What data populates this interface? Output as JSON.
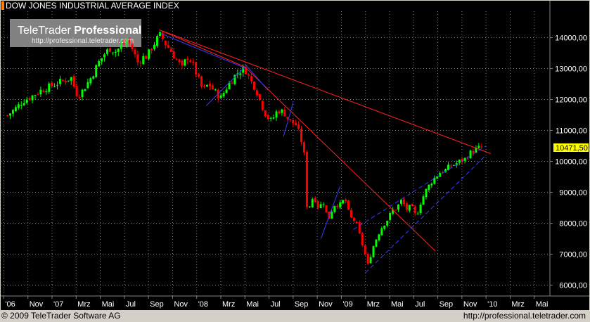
{
  "title": "DOW JONES INDUSTRIAL AVERAGE INDEX",
  "watermark": {
    "brand_plain": "TeleTrader ",
    "brand_bold": "Professional",
    "url": "http://professional.teletrader.com"
  },
  "footer": {
    "copyright": "© 2009 TeleTrader Software AG",
    "url": "http://professional.teletrader.com"
  },
  "last_price_label": "10471,50",
  "colors": {
    "background": "#000000",
    "grid": "#808080",
    "up": "#00ff00",
    "down": "#ff0000",
    "trend_red": "#ff2020",
    "trend_blue": "#3a3aff",
    "frame": "#d4d0c8",
    "title_marker": "#ff8000"
  },
  "chart_data": {
    "type": "candlestick",
    "title": "DOW JONES INDUSTRIAL AVERAGE INDEX",
    "x_tick_labels": [
      "'06",
      "Nov",
      "'07",
      "Mrz",
      "Mai",
      "Jul",
      "Sep",
      "Nov",
      "'08",
      "Mrz",
      "Mai",
      "Jul",
      "Sep",
      "Nov",
      "'09",
      "Mrz",
      "Mai",
      "Jul",
      "Sep",
      "Nov",
      "'10",
      "Mrz",
      "Mai"
    ],
    "x_tick_months": [
      9,
      11,
      13,
      15,
      17,
      19,
      21,
      23,
      25,
      27,
      29,
      31,
      33,
      35,
      37,
      39,
      41,
      43,
      45,
      47,
      49,
      51,
      53
    ],
    "y_ticks": [
      6000,
      7000,
      8000,
      9000,
      10000,
      11000,
      12000,
      13000,
      14000
    ],
    "y_tick_labels": [
      "6000,00",
      "7000,00",
      "8000,00",
      "9000,00",
      "10000,00",
      "11000,00",
      "12000,00",
      "13000,00",
      "14000,00"
    ],
    "ylim": [
      5650,
      14850
    ],
    "xlim": [
      8.8,
      54.3
    ],
    "last_price": 10471.5,
    "weekly_close_anchors": [
      [
        9.3,
        11480
      ],
      [
        10.0,
        11720
      ],
      [
        10.6,
        11950
      ],
      [
        11.3,
        12100
      ],
      [
        12.0,
        12280
      ],
      [
        12.6,
        12380
      ],
      [
        13.3,
        12500
      ],
      [
        13.9,
        12600
      ],
      [
        14.6,
        12700
      ],
      [
        15.0,
        12200
      ],
      [
        15.3,
        12150
      ],
      [
        15.8,
        12450
      ],
      [
        16.3,
        12750
      ],
      [
        16.8,
        13150
      ],
      [
        17.3,
        13450
      ],
      [
        17.8,
        13650
      ],
      [
        18.3,
        13550
      ],
      [
        18.8,
        13750
      ],
      [
        19.3,
        13900
      ],
      [
        19.7,
        13600
      ],
      [
        20.1,
        13200
      ],
      [
        20.5,
        13350
      ],
      [
        20.9,
        13400
      ],
      [
        21.3,
        13700
      ],
      [
        21.7,
        13950
      ],
      [
        22.0,
        14100
      ],
      [
        22.3,
        13850
      ],
      [
        22.8,
        13600
      ],
      [
        23.3,
        13300
      ],
      [
        23.8,
        13000
      ],
      [
        24.2,
        13400
      ],
      [
        24.6,
        13200
      ],
      [
        25.0,
        12800
      ],
      [
        25.5,
        12300
      ],
      [
        26.0,
        12500
      ],
      [
        26.5,
        12250
      ],
      [
        27.0,
        12050
      ],
      [
        27.5,
        12400
      ],
      [
        28.0,
        12700
      ],
      [
        28.5,
        12900
      ],
      [
        29.0,
        13000
      ],
      [
        29.5,
        12600
      ],
      [
        29.9,
        12350
      ],
      [
        30.3,
        11900
      ],
      [
        30.8,
        11450
      ],
      [
        31.2,
        11300
      ],
      [
        31.7,
        11650
      ],
      [
        32.2,
        11600
      ],
      [
        32.7,
        11300
      ],
      [
        33.2,
        11200
      ],
      [
        33.6,
        10800
      ],
      [
        33.9,
        10300
      ],
      [
        34.1,
        8600
      ],
      [
        34.3,
        8500
      ],
      [
        34.7,
        8900
      ],
      [
        35.1,
        8500
      ],
      [
        35.5,
        8700
      ],
      [
        35.9,
        8100
      ],
      [
        36.4,
        8600
      ],
      [
        36.9,
        8600
      ],
      [
        37.3,
        8800
      ],
      [
        37.7,
        8200
      ],
      [
        38.2,
        8050
      ],
      [
        38.6,
        7500
      ],
      [
        38.9,
        7100
      ],
      [
        39.2,
        6650
      ],
      [
        39.6,
        7200
      ],
      [
        40.0,
        7600
      ],
      [
        40.4,
        7900
      ],
      [
        40.8,
        8100
      ],
      [
        41.2,
        8400
      ],
      [
        41.6,
        8500
      ],
      [
        42.0,
        8750
      ],
      [
        42.4,
        8450
      ],
      [
        42.8,
        8550
      ],
      [
        43.2,
        8200
      ],
      [
        43.6,
        8700
      ],
      [
        44.0,
        9050
      ],
      [
        44.4,
        9300
      ],
      [
        44.8,
        9500
      ],
      [
        45.2,
        9650
      ],
      [
        45.6,
        9700
      ],
      [
        46.0,
        9850
      ],
      [
        46.4,
        9900
      ],
      [
        46.8,
        10000
      ],
      [
        47.2,
        10050
      ],
      [
        47.6,
        10250
      ],
      [
        48.0,
        10350
      ],
      [
        48.4,
        10430
      ],
      [
        48.7,
        10471.5
      ]
    ],
    "trendlines": [
      {
        "color": "red",
        "dash": "solid",
        "points": [
          [
            21.9,
            14250
          ],
          [
            49.4,
            10250
          ]
        ]
      },
      {
        "color": "red",
        "dash": "solid",
        "points": [
          [
            21.9,
            14250
          ],
          [
            29.0,
            13050
          ]
        ]
      },
      {
        "color": "red",
        "dash": "solid",
        "points": [
          [
            29.0,
            13050
          ],
          [
            44.8,
            7100
          ]
        ]
      },
      {
        "color": "blue",
        "dash": "solid",
        "points": [
          [
            21.9,
            14150
          ],
          [
            29.1,
            13000
          ]
        ]
      },
      {
        "color": "blue",
        "dash": "solid",
        "points": [
          [
            29.0,
            13150
          ],
          [
            30.9,
            12300
          ]
        ]
      },
      {
        "color": "blue",
        "dash": "solid",
        "points": [
          [
            25.8,
            11800
          ],
          [
            29.0,
            13050
          ]
        ]
      },
      {
        "color": "blue",
        "dash": "solid",
        "points": [
          [
            32.2,
            10800
          ],
          [
            33.0,
            11900
          ]
        ]
      },
      {
        "color": "blue",
        "dash": "solid",
        "points": [
          [
            35.3,
            7500
          ],
          [
            36.9,
            9200
          ]
        ]
      },
      {
        "color": "blue",
        "dash": "dashed",
        "points": [
          [
            38.0,
            7800
          ],
          [
            49.0,
            10500
          ]
        ]
      },
      {
        "color": "blue",
        "dash": "dashed",
        "points": [
          [
            39.0,
            6400
          ],
          [
            49.0,
            10200
          ]
        ]
      }
    ]
  }
}
